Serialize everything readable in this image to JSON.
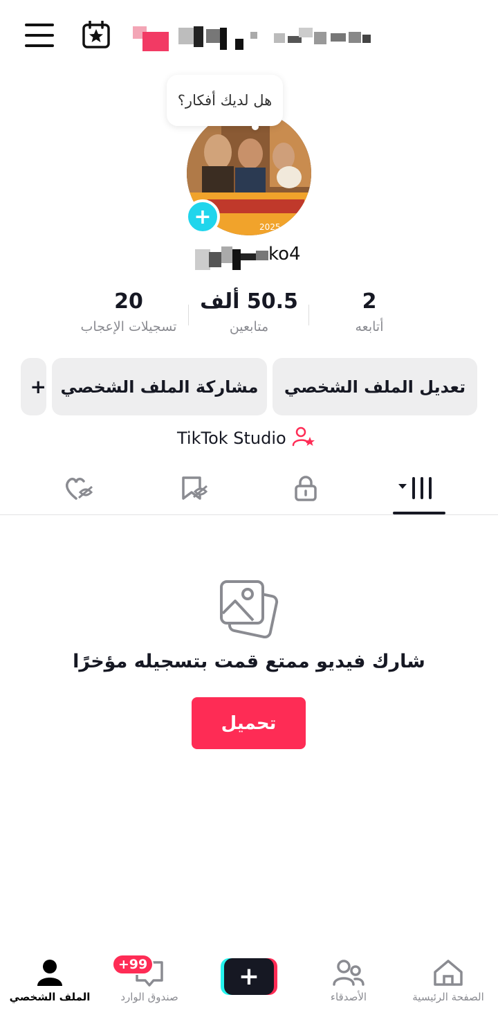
{
  "header": {
    "menu_icon": "hamburger-menu-icon",
    "calendar_icon": "calendar-star-icon"
  },
  "profile": {
    "idea_prompt": "هل لديك أفكار؟",
    "avatar_add_icon": "plus-icon",
    "username_visible_suffix": "ko4"
  },
  "stats": {
    "likes_count": "20",
    "likes_label": "تسجيلات الإعجاب",
    "followers_count": "50.5 ألف",
    "followers_label": "متابعين",
    "following_count": "2",
    "following_label": "أتابعه"
  },
  "actions": {
    "edit_profile": "تعديل الملف الشخصي",
    "share_profile": "مشاركة الملف الشخصي",
    "add_friend": "+"
  },
  "studio": {
    "label": "TikTok Studio",
    "icon": "person-star-icon"
  },
  "tabs": [
    {
      "name": "videos",
      "icon": "grid-icon",
      "active": true
    },
    {
      "name": "private",
      "icon": "lock-icon",
      "active": false
    },
    {
      "name": "saved",
      "icon": "bookmark-icon",
      "active": false
    },
    {
      "name": "liked",
      "icon": "heart-icon",
      "active": false
    }
  ],
  "empty_state": {
    "icon": "photos-icon",
    "title": "شارك فيديو ممتع قمت بتسجيله مؤخرًا",
    "upload_label": "تحميل"
  },
  "bottom_nav": {
    "home": "الصفحة الرئيسية",
    "friends": "الأصدقاء",
    "create": "+",
    "inbox": "صندوق الوارد",
    "inbox_badge": "+99",
    "profile": "الملف الشخصي"
  },
  "colors": {
    "accent": "#fe2c55",
    "avatar_add": "#20d5ec",
    "create_left": "#25f4ee",
    "create_right": "#fe2c55"
  }
}
